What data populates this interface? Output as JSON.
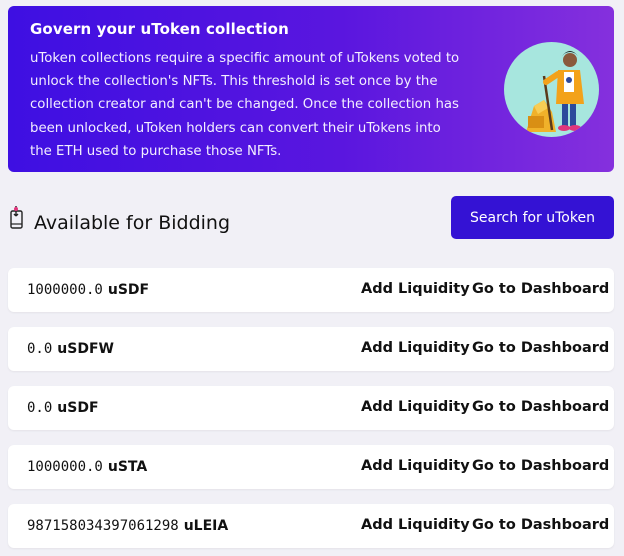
{
  "banner": {
    "title": "Govern your uToken collection",
    "body": "uToken collections require a specific amount of uTokens voted to unlock the collection's NFTs. This threshold is set once by the collection creator and can't be changed. Once the collection has been unlocked, uToken holders can convert their uTokens into the ETH used to purchase those NFTs."
  },
  "section": {
    "title": "Available for Bidding",
    "icon": "touch-pointer-icon",
    "search_button": "Search for uToken"
  },
  "rows": [
    {
      "amount": "1000000.0",
      "symbol": "uSDF",
      "add_liquidity": "Add Liquidity",
      "dashboard": "Go to Dashboard"
    },
    {
      "amount": "0.0",
      "symbol": "uSDFW",
      "add_liquidity": "Add Liquidity",
      "dashboard": "Go to Dashboard"
    },
    {
      "amount": "0.0",
      "symbol": "uSDF",
      "add_liquidity": "Add Liquidity",
      "dashboard": "Go to Dashboard"
    },
    {
      "amount": "1000000.0",
      "symbol": "uSTA",
      "add_liquidity": "Add Liquidity",
      "dashboard": "Go to Dashboard"
    },
    {
      "amount": "987158034397061298",
      "symbol": "uLEIA",
      "add_liquidity": "Add Liquidity",
      "dashboard": "Go to Dashboard"
    }
  ],
  "colors": {
    "banner_start": "#3e0fe2",
    "banner_end": "#8530dd",
    "button": "#3412d4",
    "page_bg": "#f1f0f6"
  }
}
